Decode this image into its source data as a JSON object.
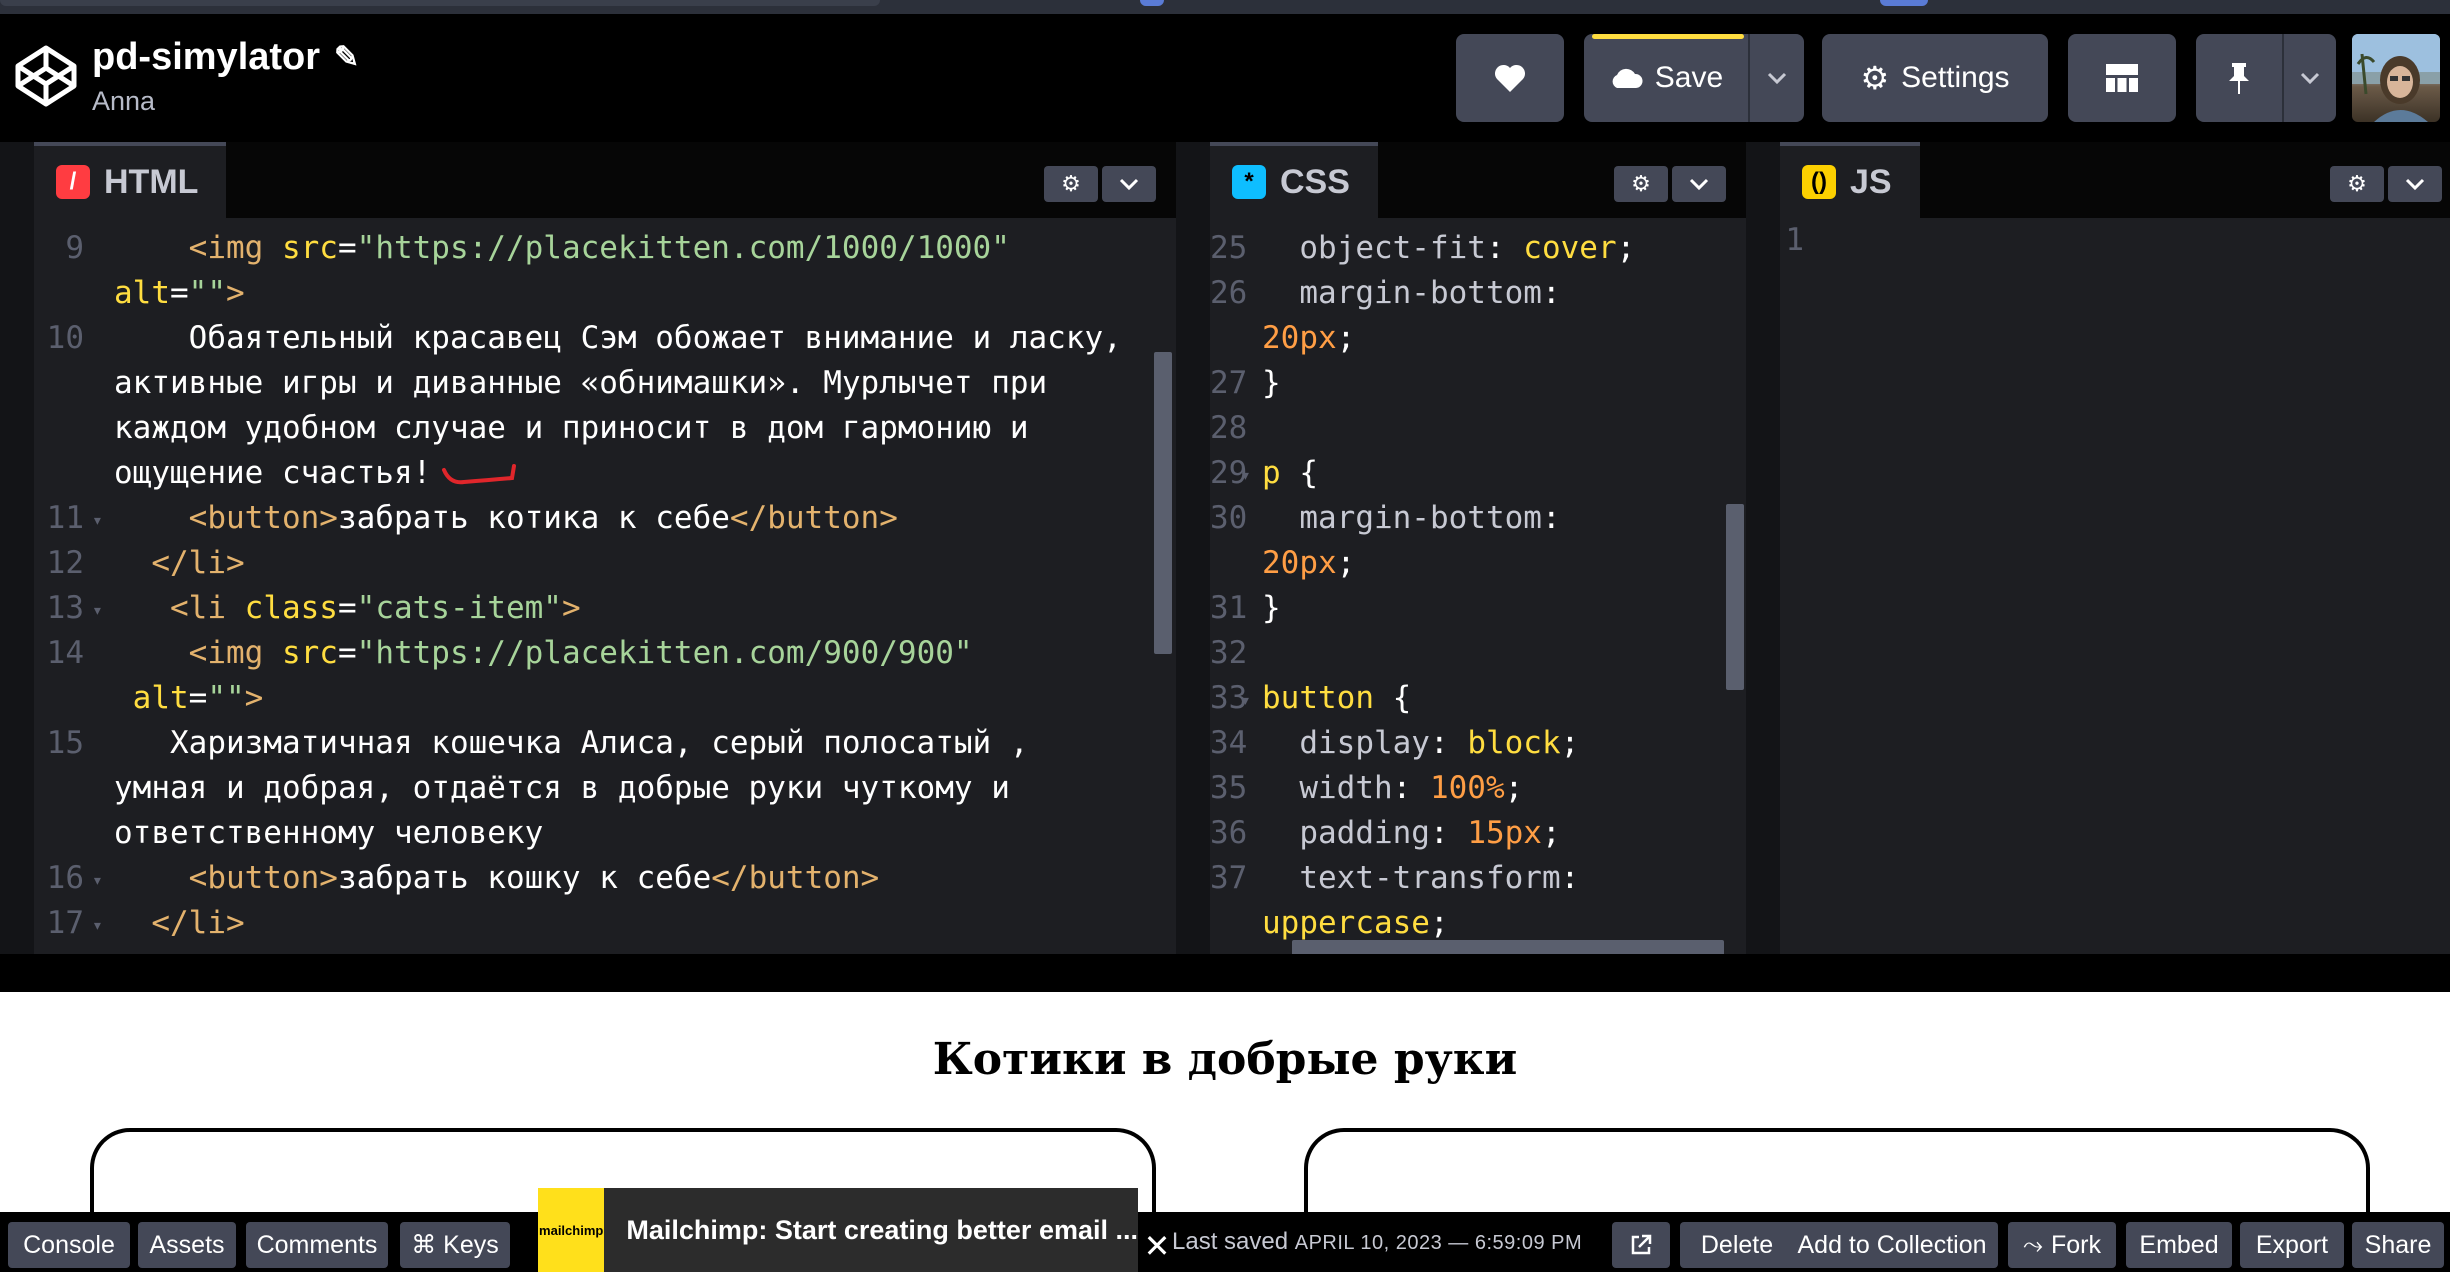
{
  "header": {
    "title": "pd-simylator",
    "author": "Anna",
    "save_label": "Save",
    "settings_label": "Settings"
  },
  "panes": {
    "html": {
      "label": "HTML",
      "lines": [
        {
          "n": "9",
          "fold": false,
          "segs": [
            [
              "plain",
              "    "
            ],
            [
              "tag",
              "<img "
            ],
            [
              "attr",
              "src"
            ],
            [
              "plain",
              "="
            ],
            [
              "str",
              "\"https://placekitten.com/1000/1000\""
            ]
          ]
        },
        {
          "n": "",
          "fold": false,
          "segs": [
            [
              "attr",
              "alt"
            ],
            [
              "plain",
              "="
            ],
            [
              "str",
              "\"\""
            ],
            [
              "tag",
              ">"
            ]
          ]
        },
        {
          "n": "10",
          "fold": false,
          "segs": [
            [
              "plain",
              "    Обаятельный красавец Сэм обожает внимание и ласку,"
            ]
          ]
        },
        {
          "n": "",
          "fold": false,
          "segs": [
            [
              "plain",
              "активные игры и диванные «обнимашки». Мурлычет при"
            ]
          ]
        },
        {
          "n": "",
          "fold": false,
          "segs": [
            [
              "plain",
              "каждом удобном случае и приносит в дом гармонию и"
            ]
          ]
        },
        {
          "n": "",
          "fold": false,
          "segs": [
            [
              "plain",
              "ощущение счастья!"
            ]
          ]
        },
        {
          "n": "11",
          "fold": true,
          "segs": [
            [
              "plain",
              "    "
            ],
            [
              "tag",
              "<button>"
            ],
            [
              "plain",
              "забрать котика к себе"
            ],
            [
              "tag",
              "</button>"
            ]
          ]
        },
        {
          "n": "12",
          "fold": false,
          "segs": [
            [
              "plain",
              "  "
            ],
            [
              "tag",
              "</li>"
            ]
          ]
        },
        {
          "n": "13",
          "fold": true,
          "segs": [
            [
              "plain",
              "   "
            ],
            [
              "tag",
              "<li "
            ],
            [
              "attr",
              "class"
            ],
            [
              "plain",
              "="
            ],
            [
              "str",
              "\"cats-item\""
            ],
            [
              "tag",
              ">"
            ]
          ]
        },
        {
          "n": "14",
          "fold": false,
          "segs": [
            [
              "plain",
              "    "
            ],
            [
              "tag",
              "<img "
            ],
            [
              "attr",
              "src"
            ],
            [
              "plain",
              "="
            ],
            [
              "str",
              "\"https://placekitten.com/900/900\""
            ]
          ]
        },
        {
          "n": "",
          "fold": false,
          "segs": [
            [
              "plain",
              " "
            ],
            [
              "attr",
              "alt"
            ],
            [
              "plain",
              "="
            ],
            [
              "str",
              "\"\""
            ],
            [
              "tag",
              ">"
            ]
          ]
        },
        {
          "n": "15",
          "fold": false,
          "segs": [
            [
              "plain",
              "   Харизматичная кошечка Алиса, серый полосатый ,"
            ]
          ]
        },
        {
          "n": "",
          "fold": false,
          "segs": [
            [
              "plain",
              "умная и добрая, отдаётся в добрые руки чуткому и"
            ]
          ]
        },
        {
          "n": "",
          "fold": false,
          "segs": [
            [
              "plain",
              "ответственному человеку"
            ]
          ]
        },
        {
          "n": "16",
          "fold": true,
          "segs": [
            [
              "plain",
              "    "
            ],
            [
              "tag",
              "<button>"
            ],
            [
              "plain",
              "забрать кошку к себе"
            ],
            [
              "tag",
              "</button>"
            ]
          ]
        },
        {
          "n": "17",
          "fold": true,
          "segs": [
            [
              "plain",
              "  "
            ],
            [
              "tag",
              "</li>"
            ]
          ]
        }
      ]
    },
    "css": {
      "label": "CSS",
      "lines": [
        {
          "n": "25",
          "fold": false,
          "segs": [
            [
              "plain",
              "  "
            ],
            [
              "prop",
              "object-fit"
            ],
            [
              "plain",
              ": "
            ],
            [
              "kw",
              "cover"
            ],
            [
              "plain",
              ";"
            ]
          ]
        },
        {
          "n": "26",
          "fold": false,
          "segs": [
            [
              "plain",
              "  "
            ],
            [
              "prop",
              "margin-bottom"
            ],
            [
              "plain",
              ":"
            ]
          ]
        },
        {
          "n": "",
          "fold": false,
          "segs": [
            [
              "num",
              "20px"
            ],
            [
              "plain",
              ";"
            ]
          ]
        },
        {
          "n": "27",
          "fold": false,
          "segs": [
            [
              "plain",
              "}"
            ]
          ]
        },
        {
          "n": "28",
          "fold": false,
          "segs": [
            [
              "plain",
              ""
            ]
          ]
        },
        {
          "n": "29",
          "fold": true,
          "segs": [
            [
              "kw",
              "p"
            ],
            [
              "plain",
              " {"
            ]
          ]
        },
        {
          "n": "30",
          "fold": false,
          "segs": [
            [
              "plain",
              "  "
            ],
            [
              "prop",
              "margin-bottom"
            ],
            [
              "plain",
              ":"
            ]
          ]
        },
        {
          "n": "",
          "fold": false,
          "segs": [
            [
              "num",
              "20px"
            ],
            [
              "plain",
              ";"
            ]
          ]
        },
        {
          "n": "31",
          "fold": false,
          "segs": [
            [
              "plain",
              "}"
            ]
          ]
        },
        {
          "n": "32",
          "fold": false,
          "segs": [
            [
              "plain",
              ""
            ]
          ]
        },
        {
          "n": "33",
          "fold": true,
          "segs": [
            [
              "kw",
              "button"
            ],
            [
              "plain",
              " {"
            ]
          ]
        },
        {
          "n": "34",
          "fold": false,
          "segs": [
            [
              "plain",
              "  "
            ],
            [
              "prop",
              "display"
            ],
            [
              "plain",
              ": "
            ],
            [
              "kw",
              "block"
            ],
            [
              "plain",
              ";"
            ]
          ]
        },
        {
          "n": "35",
          "fold": false,
          "segs": [
            [
              "plain",
              "  "
            ],
            [
              "prop",
              "width"
            ],
            [
              "plain",
              ": "
            ],
            [
              "num",
              "100%"
            ],
            [
              "plain",
              ";"
            ]
          ]
        },
        {
          "n": "36",
          "fold": false,
          "segs": [
            [
              "plain",
              "  "
            ],
            [
              "prop",
              "padding"
            ],
            [
              "plain",
              ": "
            ],
            [
              "num",
              "15px"
            ],
            [
              "plain",
              ";"
            ]
          ]
        },
        {
          "n": "37",
          "fold": false,
          "segs": [
            [
              "plain",
              "  "
            ],
            [
              "prop",
              "text-transform"
            ],
            [
              "plain",
              ":"
            ]
          ]
        },
        {
          "n": "",
          "fold": false,
          "segs": [
            [
              "kw",
              "uppercase"
            ],
            [
              "plain",
              ";"
            ]
          ]
        }
      ]
    },
    "js": {
      "label": "JS",
      "lines": [
        {
          "n": "1",
          "fold": false,
          "segs": [
            [
              "plain",
              ""
            ]
          ]
        }
      ]
    }
  },
  "preview": {
    "title": "Котики в добрые руки"
  },
  "footer": {
    "console": "Console",
    "assets": "Assets",
    "comments": "Comments",
    "keys": "⌘ Keys",
    "ad_text": "Mailchimp: Start creating better email ...",
    "ad_logo": "mailchimp",
    "saved_prefix": "Last saved",
    "saved_date": "APRIL 10, 2023 — 6:59:09 PM",
    "delete": "Delete",
    "add_to_collection": "Add to Collection",
    "fork": "Fork",
    "embed": "Embed",
    "export": "Export",
    "share": "Share"
  },
  "colors": {
    "accent_yellow": "#ffdd40",
    "html_tag": "#ff3c41",
    "css_tag": "#0ebeff",
    "js_tag": "#fcd000",
    "button_bg": "#444857"
  }
}
